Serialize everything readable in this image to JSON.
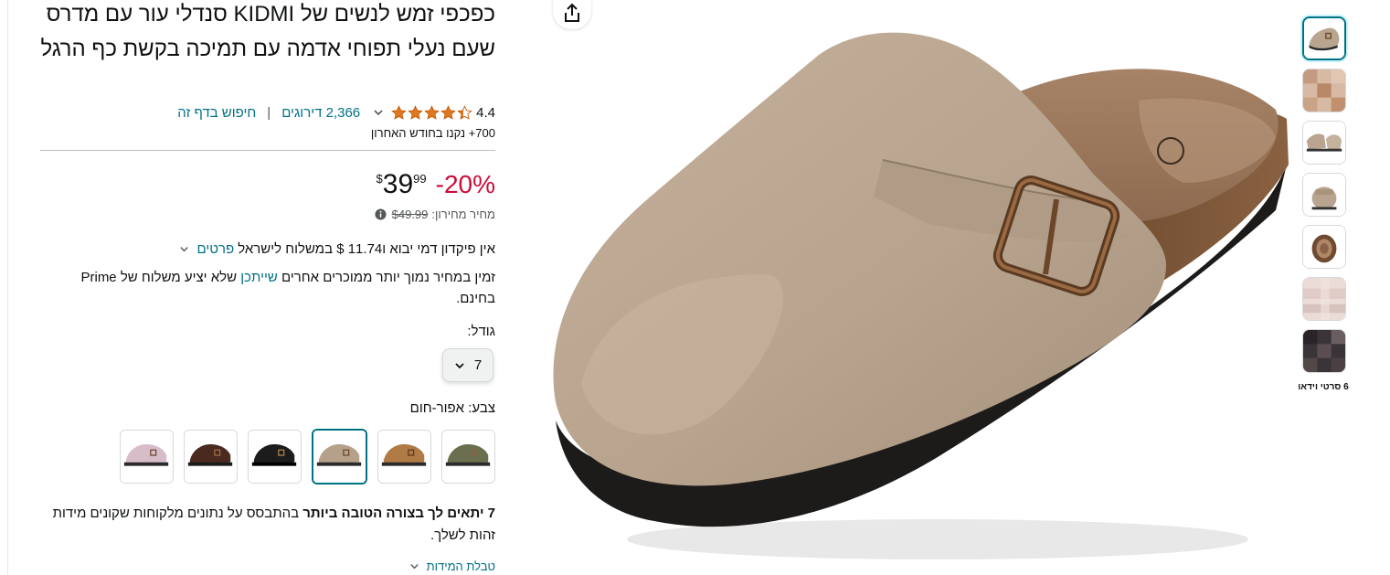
{
  "product": {
    "title": "כפכפי זמש לנשים של KIDMI סנדלי עור עם מדרס שעם נעלי תפוחי אדמה עם תמיכה בקשת כף הרגל",
    "rating": "4.4",
    "rating_value": 4.4,
    "ratings_count": "2,366 דירוגים",
    "separator": "|",
    "search_link": "חיפוש בדף זה",
    "bought_recently": "700+ נקנו בחודש האחרון"
  },
  "price": {
    "discount": "-20%",
    "currency": "$",
    "whole": "39",
    "fraction": "99",
    "list_label": "מחיר מחירון:",
    "list_value": "$49.99"
  },
  "shipping": {
    "text": "אין פיקדון דמי יבוא ו11.74 $ במשלוח לישראל",
    "details_link": "פרטים"
  },
  "availability": {
    "before": "זמין במחיר נמוך יותר ממוכרים אחרים",
    "link": "שייתכן",
    "after": "שלא יציע משלוח של Prime בחינם."
  },
  "size": {
    "label": "גודל:",
    "selected": "7"
  },
  "color": {
    "label": "צבע:",
    "selected": "אפור-חום",
    "swatches": [
      {
        "name": "olive",
        "hex": "#6b6f4f"
      },
      {
        "name": "tan",
        "hex": "#b07a45"
      },
      {
        "name": "taupe",
        "hex": "#b5a08a"
      },
      {
        "name": "black",
        "hex": "#1c1c1c"
      },
      {
        "name": "brown",
        "hex": "#4a2a20"
      },
      {
        "name": "pink",
        "hex": "#d7bcc9"
      }
    ]
  },
  "fit": {
    "bold": "7 יתאים לך בצורה הטובה ביותר",
    "rest": "בהתבסס על נתונים מלקוחות שקונים מידות זהות לשלך."
  },
  "size_chart_link": "טבלת המידות",
  "thumbnails": {
    "count": 7,
    "video_label": "6 סרטי וידאו"
  },
  "icons": {
    "share": "share-icon",
    "star": "star-icon",
    "chevron": "chevron-down-icon",
    "info": "info-icon"
  },
  "colors": {
    "link": "#007185",
    "discount": "#cc0c39",
    "star": "#de7921"
  }
}
